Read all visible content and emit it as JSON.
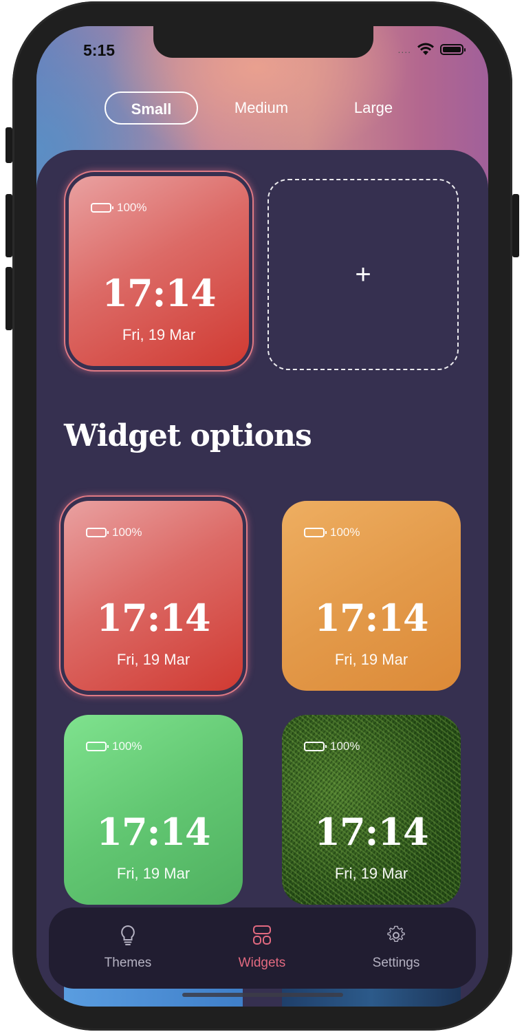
{
  "status_bar": {
    "time": "5:15",
    "signal": "....",
    "icons": [
      "wifi-icon",
      "battery-icon"
    ]
  },
  "size_tabs": [
    {
      "label": "Small",
      "active": true
    },
    {
      "label": "Medium",
      "active": false
    },
    {
      "label": "Large",
      "active": false
    }
  ],
  "current_widgets": {
    "widget": {
      "battery": "100%",
      "time": "17:14",
      "date": "Fri, 19 Mar",
      "theme": "red"
    },
    "add_slot": {
      "icon": "plus-icon",
      "label": "+"
    }
  },
  "options_title": "Widget options",
  "widget_options": [
    {
      "battery": "100%",
      "time": "17:14",
      "date": "Fri, 19 Mar",
      "theme": "red",
      "selected": true
    },
    {
      "battery": "100%",
      "time": "17:14",
      "date": "Fri, 19 Mar",
      "theme": "orange",
      "selected": false
    },
    {
      "battery": "100%",
      "time": "17:14",
      "date": "Fri, 19 Mar",
      "theme": "green",
      "selected": false
    },
    {
      "battery": "100%",
      "time": "17:14",
      "date": "Fri, 19 Mar",
      "theme": "grass",
      "selected": false
    }
  ],
  "tab_bar": [
    {
      "label": "Themes",
      "icon": "lightbulb-icon",
      "active": false
    },
    {
      "label": "Widgets",
      "icon": "widgets-icon",
      "active": true
    },
    {
      "label": "Settings",
      "icon": "gear-icon",
      "active": false
    }
  ],
  "colors": {
    "background": "#363050",
    "accent": "#e36a80",
    "tab_bar": "#211d31"
  }
}
